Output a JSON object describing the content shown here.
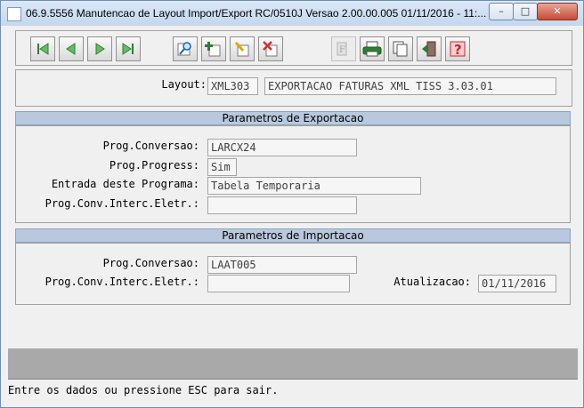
{
  "window": {
    "title": "06.9.5556 Manutencao  de Layout Import/Export RC/0510J Versao 2.00.00.005 01/11/2016 - 11:..."
  },
  "toolbar": {
    "icons": [
      "first-record-icon",
      "previous-record-icon",
      "next-record-icon",
      "last-record-icon",
      "search-icon",
      "add-icon",
      "edit-icon",
      "delete-icon",
      "filter-icon",
      "print-icon",
      "copy-icon",
      "exit-icon",
      "help-icon"
    ],
    "help_glyph": "?"
  },
  "layout": {
    "label": "Layout:",
    "code": "XML303",
    "description": "EXPORTACAO FATURAS XML TISS 3.03.01"
  },
  "export": {
    "header": "Parametros de Exportacao",
    "prog_conversao_label": "Prog.Conversao:",
    "prog_conversao_value": "LARCX24",
    "prog_progress_label": "Prog.Progress:",
    "prog_progress_value": "Sim",
    "entrada_label": "Entrada deste Programa:",
    "entrada_value": "Tabela Temporaria",
    "prog_conv_interc_label": "Prog.Conv.Interc.Eletr.:",
    "prog_conv_interc_value": ""
  },
  "import": {
    "header": "Parametros de Importacao",
    "prog_conversao_label": "Prog.Conversao:",
    "prog_conversao_value": "LAAT005",
    "prog_conv_interc_label": "Prog.Conv.Interc.Eletr.:",
    "prog_conv_interc_value": "",
    "atualizacao_label": "Atualizacao:",
    "atualizacao_value": "01/11/2016"
  },
  "status_bar": {
    "text": "Entre os dados ou pressione ESC para sair."
  },
  "colors": {
    "section_bar": "#b9c9dd",
    "close_button": "#c74a32"
  }
}
